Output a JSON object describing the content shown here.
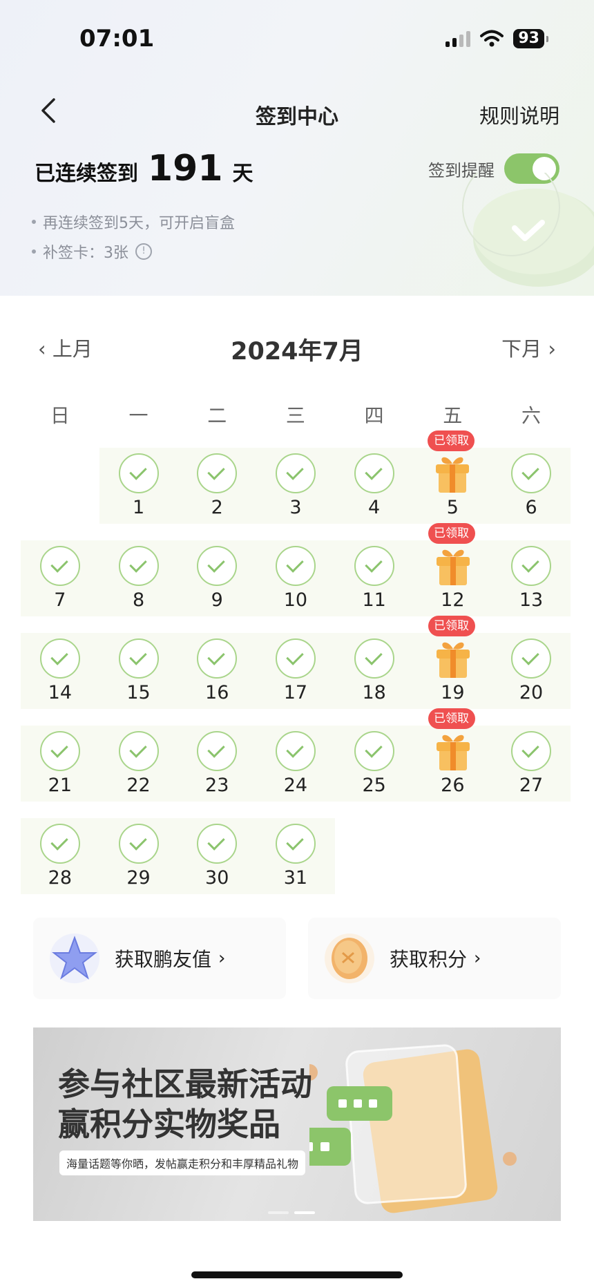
{
  "status_bar": {
    "time": "07:01",
    "battery": "93"
  },
  "nav": {
    "title": "签到中心",
    "rules": "规则说明"
  },
  "streak": {
    "prefix": "已连续签到",
    "days": "191",
    "unit": "天"
  },
  "info": {
    "line1": "再连续签到5天，可开启盲盒",
    "line2": "补签卡：3张"
  },
  "reminder": {
    "label": "签到提醒",
    "enabled": true
  },
  "calendar": {
    "month": "2024年7月",
    "prev": "上月",
    "next": "下月",
    "weekdays": [
      "日",
      "一",
      "二",
      "三",
      "四",
      "五",
      "六"
    ],
    "claimed_label": "已领取",
    "days": [
      "1",
      "2",
      "3",
      "4",
      "5",
      "6",
      "7",
      "8",
      "9",
      "10",
      "11",
      "12",
      "13",
      "14",
      "15",
      "16",
      "17",
      "18",
      "19",
      "20",
      "21",
      "22",
      "23",
      "24",
      "25",
      "26",
      "27",
      "28",
      "29",
      "30",
      "31"
    ]
  },
  "cards": {
    "friend_value": "获取鹏友值",
    "points": "获取积分"
  },
  "banner": {
    "line1": "参与社区最新活动",
    "line2": "赢积分实物奖品",
    "sub": "海量话题等你晒，发帖赢走积分和丰厚精品礼物"
  },
  "colors": {
    "accent_green": "#8cc56a",
    "badge_red": "#ef5050"
  }
}
